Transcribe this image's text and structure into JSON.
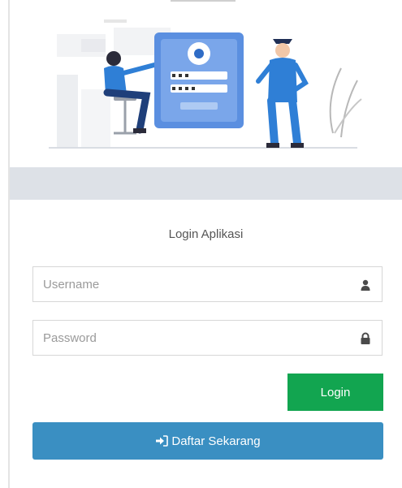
{
  "header": {
    "illustration_icon": "login-illustration"
  },
  "form": {
    "title": "Login Aplikasi",
    "username": {
      "placeholder": "Username",
      "value": "",
      "icon": "user-icon"
    },
    "password": {
      "placeholder": "Password",
      "value": "",
      "icon": "lock-icon"
    },
    "login_label": "Login",
    "register_label": "Daftar Sekarang",
    "register_icon": "sign-in-icon"
  },
  "colors": {
    "login_button": "#12a550",
    "register_button": "#3a8fc2",
    "band": "#dde1e7"
  }
}
